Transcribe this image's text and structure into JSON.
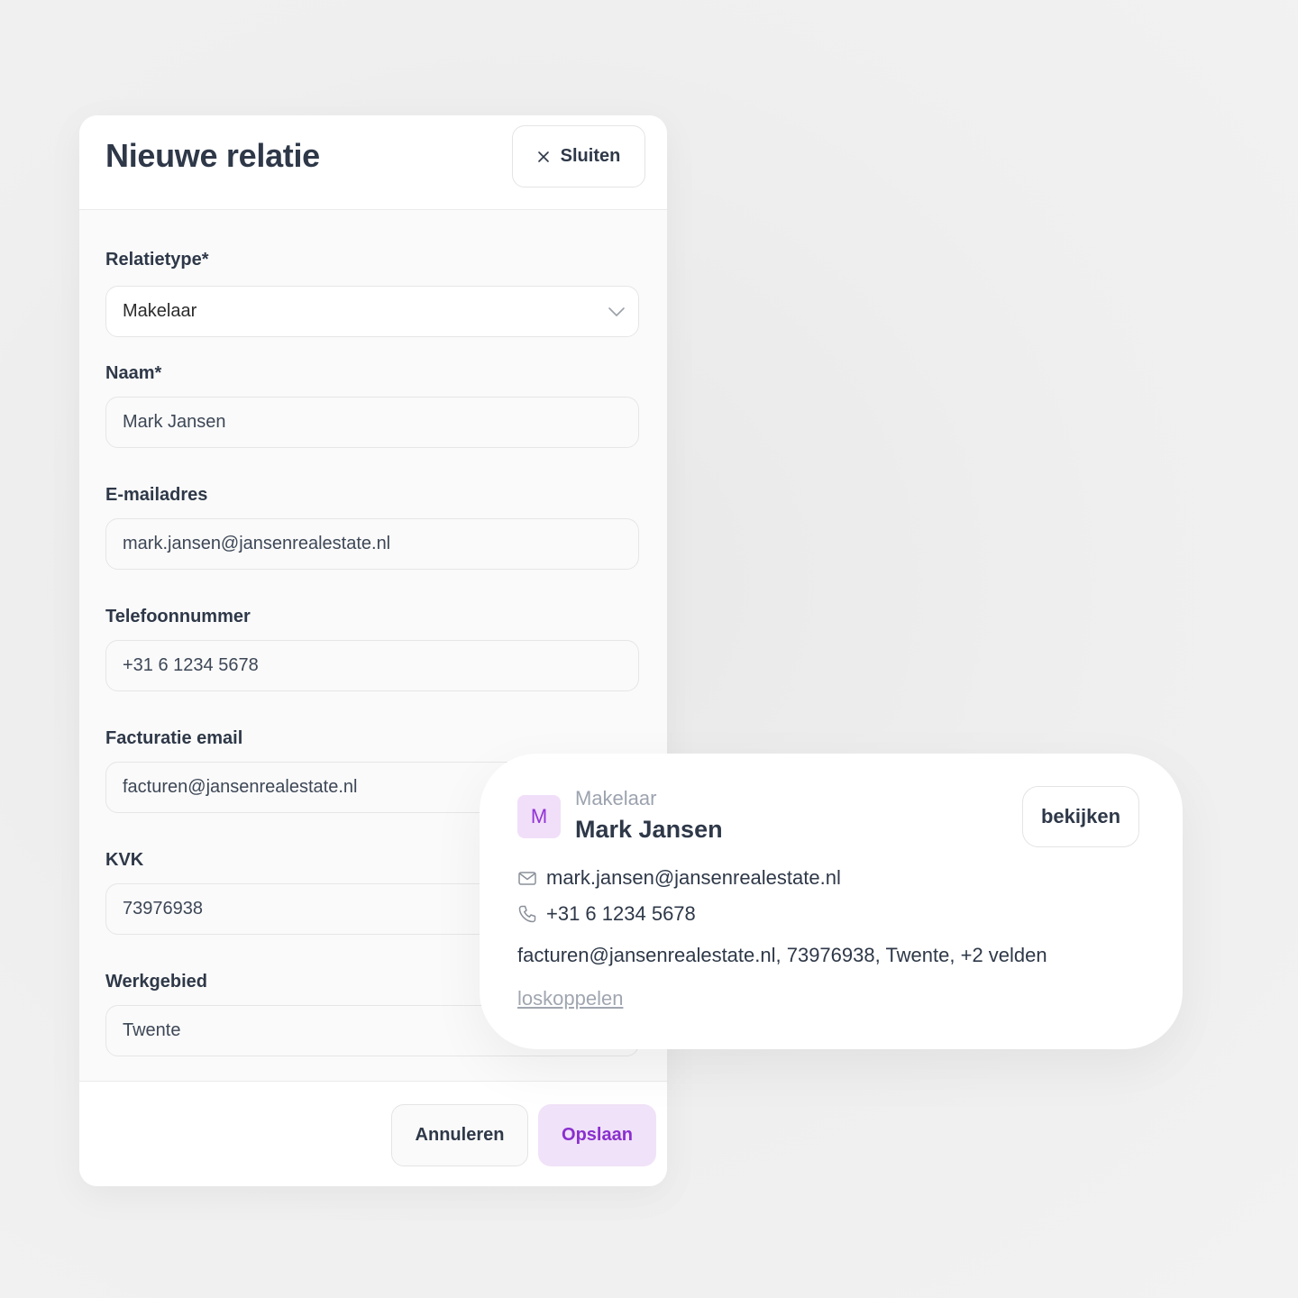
{
  "modal": {
    "title": "Nieuwe relatie",
    "close_label": "Sluiten",
    "fields": {
      "relation_type": {
        "label": "Relatietype*",
        "value": "Makelaar"
      },
      "name": {
        "label": "Naam*",
        "value": "Mark Jansen"
      },
      "email": {
        "label": "E-mailadres",
        "value": "mark.jansen@jansenrealestate.nl"
      },
      "phone": {
        "label": "Telefoonnummer",
        "value": "+31 6 1234 5678"
      },
      "billing_email": {
        "label": "Facturatie email",
        "value": "facturen@jansenrealestate.nl"
      },
      "kvk": {
        "label": "KVK",
        "value": "73976938"
      },
      "region": {
        "label": "Werkgebied",
        "value": "Twente"
      }
    },
    "footer": {
      "cancel_label": "Annuleren",
      "save_label": "Opslaan"
    }
  },
  "card": {
    "avatar_initial": "M",
    "type": "Makelaar",
    "name": "Mark Jansen",
    "view_label": "bekijken",
    "email": "mark.jansen@jansenrealestate.nl",
    "phone": "+31 6 1234 5678",
    "summary": "facturen@jansenrealestate.nl, 73976938, Twente, +2 velden",
    "unlink_label": "loskoppelen"
  },
  "colors": {
    "accent": "#8a2fcf",
    "accent_bg": "#f0e2f8",
    "text": "#2e3848",
    "muted": "#9ca3af"
  },
  "icons": [
    "close-icon",
    "chevron-down-icon",
    "mail-icon",
    "phone-icon"
  ]
}
